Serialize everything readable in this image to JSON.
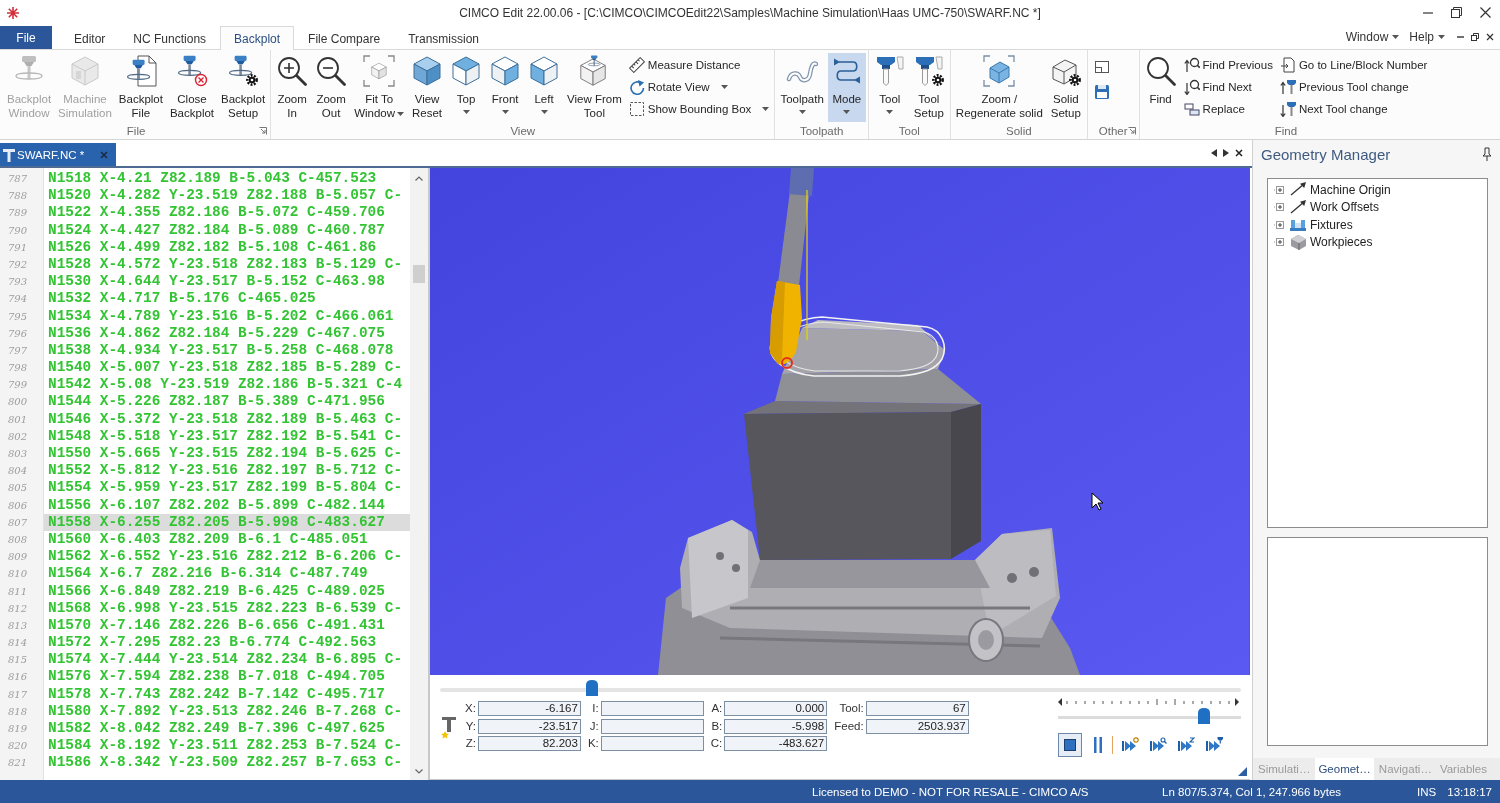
{
  "window": {
    "title": "CIMCO Edit 22.00.06 - [C:\\CIMCO\\CIMCOEdit22\\Samples\\Machine Simulation\\Haas UMC-750\\SWARF.NC *]"
  },
  "menu": {
    "tabs": [
      {
        "label": "File",
        "kind": "file",
        "selected": false
      },
      {
        "label": "Editor",
        "kind": "tab",
        "selected": false
      },
      {
        "label": "NC Functions",
        "kind": "tab",
        "selected": false
      },
      {
        "label": "Backplot",
        "kind": "tab",
        "selected": true
      },
      {
        "label": "File Compare",
        "kind": "tab",
        "selected": false
      },
      {
        "label": "Transmission",
        "kind": "tab",
        "selected": false
      }
    ],
    "right": [
      "Window",
      "Help"
    ]
  },
  "ribbon": {
    "groups": [
      {
        "label": "File",
        "launcher": true,
        "items": [
          {
            "kind": "large",
            "label": "Backplot\nWindow",
            "disabled": true
          },
          {
            "kind": "large",
            "label": "Machine\nSimulation",
            "disabled": true
          },
          {
            "kind": "large",
            "label": "Backplot\nFile",
            "disabled": false
          },
          {
            "kind": "large",
            "label": "Close\nBackplot",
            "disabled": false
          },
          {
            "kind": "large",
            "label": "Backplot\nSetup",
            "disabled": false
          }
        ]
      },
      {
        "label": "View",
        "items": [
          {
            "kind": "large",
            "label": "Zoom\nIn"
          },
          {
            "kind": "large",
            "label": "Zoom\nOut"
          },
          {
            "kind": "large",
            "label": "Fit To\nWindow",
            "dropdown": true
          },
          {
            "kind": "large",
            "label": "View\nReset"
          },
          {
            "kind": "large",
            "label": "Top",
            "dropdown": true
          },
          {
            "kind": "large",
            "label": "Front",
            "dropdown": true
          },
          {
            "kind": "large",
            "label": "Left",
            "dropdown": true
          },
          {
            "kind": "large",
            "label": "View From\nTool"
          },
          {
            "kind": "stack",
            "items": [
              {
                "kind": "small",
                "label": "Measure Distance"
              },
              {
                "kind": "small",
                "label": "Rotate View",
                "dropdown": true
              },
              {
                "kind": "small",
                "label": "Show Bounding Box",
                "dropdown": true
              }
            ]
          }
        ]
      },
      {
        "label": "Toolpath",
        "items": [
          {
            "kind": "large",
            "label": "Toolpath",
            "dropdown": true,
            "selected": false
          },
          {
            "kind": "large",
            "label": "Mode",
            "dropdown": true,
            "selected": true
          }
        ]
      },
      {
        "label": "Tool",
        "items": [
          {
            "kind": "large",
            "label": "Tool",
            "dropdown": true
          },
          {
            "kind": "large",
            "label": "Tool\nSetup"
          }
        ]
      },
      {
        "label": "Solid",
        "items": [
          {
            "kind": "large",
            "label": "Zoom /\nRegenerate solid"
          },
          {
            "kind": "large",
            "label": "Solid\nSetup"
          }
        ]
      },
      {
        "label": "Other",
        "launcher": true,
        "items": [
          {
            "kind": "stack",
            "items": [
              {
                "kind": "icon"
              },
              {
                "kind": "icon"
              }
            ]
          }
        ]
      },
      {
        "label": "Find",
        "items": [
          {
            "kind": "large",
            "label": "Find"
          },
          {
            "kind": "stack",
            "items": [
              {
                "kind": "small",
                "label": "Find Previous"
              },
              {
                "kind": "small",
                "label": "Find Next"
              },
              {
                "kind": "small",
                "label": "Replace"
              }
            ]
          },
          {
            "kind": "stack",
            "items": [
              {
                "kind": "small",
                "label": "Go to Line/Block Number"
              },
              {
                "kind": "small",
                "label": "Previous Tool change"
              },
              {
                "kind": "small",
                "label": "Next Tool change"
              }
            ]
          }
        ]
      }
    ]
  },
  "document_tabs": [
    {
      "label": "SWARF.NC *",
      "selected": true
    }
  ],
  "editor": {
    "lines": [
      {
        "number": "787",
        "text": "N1518 X-4.21 Z82.189 B-5.043 C-457.523",
        "selected": false
      },
      {
        "number": "788",
        "text": "N1520 X-4.282 Y-23.519 Z82.188 B-5.057 C-",
        "selected": false
      },
      {
        "number": "789",
        "text": "N1522 X-4.355 Z82.186 B-5.072 C-459.706",
        "selected": false
      },
      {
        "number": "790",
        "text": "N1524 X-4.427 Z82.184 B-5.089 C-460.787",
        "selected": false
      },
      {
        "number": "791",
        "text": "N1526 X-4.499 Z82.182 B-5.108 C-461.86",
        "selected": false
      },
      {
        "number": "792",
        "text": "N1528 X-4.572 Y-23.518 Z82.183 B-5.129 C-",
        "selected": false
      },
      {
        "number": "793",
        "text": "N1530 X-4.644 Y-23.517 B-5.152 C-463.98",
        "selected": false
      },
      {
        "number": "794",
        "text": "N1532 X-4.717 B-5.176 C-465.025",
        "selected": false
      },
      {
        "number": "795",
        "text": "N1534 X-4.789 Y-23.516 B-5.202 C-466.061",
        "selected": false
      },
      {
        "number": "796",
        "text": "N1536 X-4.862 Z82.184 B-5.229 C-467.075",
        "selected": false
      },
      {
        "number": "797",
        "text": "N1538 X-4.934 Y-23.517 B-5.258 C-468.078",
        "selected": false
      },
      {
        "number": "798",
        "text": "N1540 X-5.007 Y-23.518 Z82.185 B-5.289 C-",
        "selected": false
      },
      {
        "number": "799",
        "text": "N1542 X-5.08 Y-23.519 Z82.186 B-5.321 C-4",
        "selected": false
      },
      {
        "number": "800",
        "text": "N1544 X-5.226 Z82.187 B-5.389 C-471.956",
        "selected": false
      },
      {
        "number": "801",
        "text": "N1546 X-5.372 Y-23.518 Z82.189 B-5.463 C-",
        "selected": false
      },
      {
        "number": "802",
        "text": "N1548 X-5.518 Y-23.517 Z82.192 B-5.541 C-",
        "selected": false
      },
      {
        "number": "803",
        "text": "N1550 X-5.665 Y-23.515 Z82.194 B-5.625 C-",
        "selected": false
      },
      {
        "number": "804",
        "text": "N1552 X-5.812 Y-23.516 Z82.197 B-5.712 C-",
        "selected": false
      },
      {
        "number": "805",
        "text": "N1554 X-5.959 Y-23.517 Z82.199 B-5.804 C-",
        "selected": false
      },
      {
        "number": "806",
        "text": "N1556 X-6.107 Z82.202 B-5.899 C-482.144",
        "selected": false
      },
      {
        "number": "807",
        "text": "N1558 X-6.255 Z82.205 B-5.998 C-483.627",
        "selected": true
      },
      {
        "number": "808",
        "text": "N1560 X-6.403 Z82.209 B-6.1 C-485.051",
        "selected": false
      },
      {
        "number": "809",
        "text": "N1562 X-6.552 Y-23.516 Z82.212 B-6.206 C-",
        "selected": false
      },
      {
        "number": "810",
        "text": "N1564 X-6.7 Z82.216 B-6.314 C-487.749",
        "selected": false
      },
      {
        "number": "811",
        "text": "N1566 X-6.849 Z82.219 B-6.425 C-489.025",
        "selected": false
      },
      {
        "number": "812",
        "text": "N1568 X-6.998 Y-23.515 Z82.223 B-6.539 C-",
        "selected": false
      },
      {
        "number": "813",
        "text": "N1570 X-7.146 Z82.226 B-6.656 C-491.431",
        "selected": false
      },
      {
        "number": "814",
        "text": "N1572 X-7.295 Z82.23 B-6.774 C-492.563",
        "selected": false
      },
      {
        "number": "815",
        "text": "N1574 X-7.444 Y-23.514 Z82.234 B-6.895 C-",
        "selected": false
      },
      {
        "number": "816",
        "text": "N1576 X-7.594 Z82.238 B-7.018 C-494.705",
        "selected": false
      },
      {
        "number": "817",
        "text": "N1578 X-7.743 Z82.242 B-7.142 C-495.717",
        "selected": false
      },
      {
        "number": "818",
        "text": "N1580 X-7.892 Y-23.513 Z82.246 B-7.268 C-",
        "selected": false
      },
      {
        "number": "819",
        "text": "N1582 X-8.042 Z82.249 B-7.396 C-497.625",
        "selected": false
      },
      {
        "number": "820",
        "text": "N1584 X-8.192 Y-23.511 Z82.253 B-7.524 C-",
        "selected": false
      },
      {
        "number": "821",
        "text": "N1586 X-8.342 Y-23.509 Z82.257 B-7.653 C-",
        "selected": false
      }
    ]
  },
  "playback": {
    "level": 0.19,
    "readout_columns": [
      [
        {
          "label": "X:",
          "value": "-6.167"
        },
        {
          "label": "Y:",
          "value": "-23.517"
        },
        {
          "label": "Z:",
          "value": "82.203"
        }
      ],
      [
        {
          "label": "I:"
        },
        {
          "label": "J:"
        },
        {
          "label": "K:"
        }
      ],
      [
        {
          "label": "A:",
          "value": "0.000"
        },
        {
          "label": "B:",
          "value": "-5.998"
        },
        {
          "label": "C:",
          "value": "-483.627"
        }
      ],
      [
        {
          "label": "Tool:",
          "value": "67"
        },
        {
          "label": "Feed:",
          "value": "2503.937"
        }
      ]
    ],
    "speed": {
      "level": 0.8
    },
    "buttons": [
      {
        "selected": true
      },
      {
        "selected": false
      },
      {
        "selected": false
      },
      {
        "selected": false
      },
      {
        "selected": false
      },
      {
        "selected": false
      }
    ]
  },
  "geometry_manager": {
    "title": "Geometry Manager",
    "tree": [
      {
        "label": "Machine Origin",
        "expanded": false
      },
      {
        "label": "Work Offsets",
        "expanded": false
      },
      {
        "label": "Fixtures",
        "expanded": false
      },
      {
        "label": "Workpieces",
        "expanded": false
      }
    ],
    "tabs": [
      {
        "label": "Simulati…",
        "selected": false
      },
      {
        "label": "Geomet…",
        "selected": true
      },
      {
        "label": "Navigati…",
        "selected": false
      },
      {
        "label": "Variables",
        "selected": false
      }
    ]
  },
  "status_bar": [
    "Licensed to DEMO - NOT FOR RESALE - CIMCO A/S",
    "Ln 807/5.374, Col 1, 247.966 bytes",
    "INS",
    "13:18:17"
  ]
}
